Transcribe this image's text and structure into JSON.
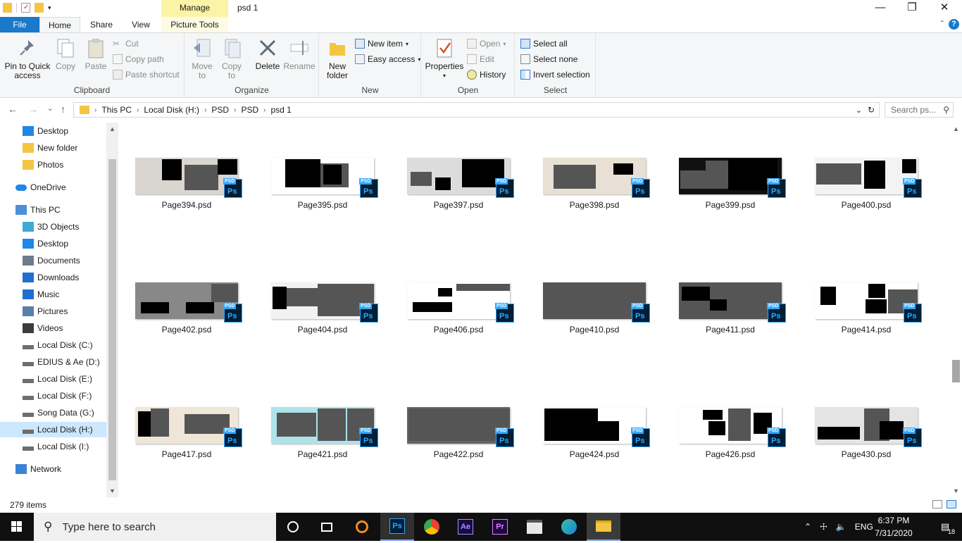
{
  "window": {
    "title": "psd 1",
    "manage_tab": "Manage"
  },
  "ribbon_tabs": {
    "file": "File",
    "home": "Home",
    "share": "Share",
    "view": "View",
    "picture_tools": "Picture Tools"
  },
  "clipboard": {
    "pin": "Pin to Quick access",
    "copy": "Copy",
    "paste": "Paste",
    "cut": "Cut",
    "copy_path": "Copy path",
    "paste_shortcut": "Paste shortcut",
    "label": "Clipboard"
  },
  "organize": {
    "move_to": "Move to",
    "copy_to": "Copy to",
    "delete": "Delete",
    "rename": "Rename",
    "label": "Organize"
  },
  "new": {
    "new_folder": "New folder",
    "new_item": "New item",
    "easy_access": "Easy access",
    "label": "New"
  },
  "open": {
    "properties": "Properties",
    "open": "Open",
    "edit": "Edit",
    "history": "History",
    "label": "Open"
  },
  "select": {
    "select_all": "Select all",
    "select_none": "Select none",
    "invert": "Invert selection",
    "label": "Select"
  },
  "address": {
    "crumbs": [
      "This PC",
      "Local Disk (H:)",
      "PSD",
      "PSD",
      "psd 1"
    ],
    "search_placeholder": "Search ps..."
  },
  "nav": {
    "items": [
      {
        "label": "Desktop",
        "icon": "desktop-icon"
      },
      {
        "label": "New folder",
        "icon": "folder-icon"
      },
      {
        "label": "Photos",
        "icon": "folder-icon"
      },
      {
        "label": "OneDrive",
        "icon": "cloud-icon"
      },
      {
        "label": "This PC",
        "icon": "computer-icon"
      },
      {
        "label": "3D Objects",
        "icon": "cube-icon"
      },
      {
        "label": "Desktop",
        "icon": "desktop-icon"
      },
      {
        "label": "Documents",
        "icon": "documents-icon"
      },
      {
        "label": "Downloads",
        "icon": "download-icon"
      },
      {
        "label": "Music",
        "icon": "music-icon"
      },
      {
        "label": "Pictures",
        "icon": "pictures-icon"
      },
      {
        "label": "Videos",
        "icon": "videos-icon"
      },
      {
        "label": "Local Disk (C:)",
        "icon": "drive-icon"
      },
      {
        "label": "EDIUS & Ae (D:)",
        "icon": "drive-icon"
      },
      {
        "label": "Local Disk (E:)",
        "icon": "drive-icon"
      },
      {
        "label": "Local Disk (F:)",
        "icon": "drive-icon"
      },
      {
        "label": "Song Data (G:)",
        "icon": "drive-icon"
      },
      {
        "label": "Local Disk (H:)",
        "icon": "drive-icon"
      },
      {
        "label": "Local Disk (I:)",
        "icon": "drive-icon"
      },
      {
        "label": "Network",
        "icon": "network-icon"
      }
    ]
  },
  "files": [
    {
      "name": "Page394.psd"
    },
    {
      "name": "Page395.psd"
    },
    {
      "name": "Page397.psd"
    },
    {
      "name": "Page398.psd"
    },
    {
      "name": "Page399.psd"
    },
    {
      "name": "Page400.psd"
    },
    {
      "name": "Page402.psd"
    },
    {
      "name": "Page404.psd"
    },
    {
      "name": "Page406.psd"
    },
    {
      "name": "Page410.psd"
    },
    {
      "name": "Page411.psd"
    },
    {
      "name": "Page414.psd"
    },
    {
      "name": "Page417.psd"
    },
    {
      "name": "Page421.psd"
    },
    {
      "name": "Page422.psd"
    },
    {
      "name": "Page424.psd"
    },
    {
      "name": "Page426.psd"
    },
    {
      "name": "Page430.psd"
    }
  ],
  "psd_badge": {
    "label": "PSD",
    "ps": "Ps"
  },
  "status": {
    "count": "279 items"
  },
  "taskbar": {
    "search_placeholder": "Type here to search",
    "time": "6:37 PM",
    "date": "7/31/2020",
    "lang": "ENG",
    "notif_count": "18",
    "ae": "Ae",
    "pr": "Pr",
    "ps": "Ps"
  },
  "colors": {
    "accent": "#1979ca",
    "selected": "#cce8ff",
    "manage": "#fbf4a7",
    "taskbar": "#101010"
  }
}
